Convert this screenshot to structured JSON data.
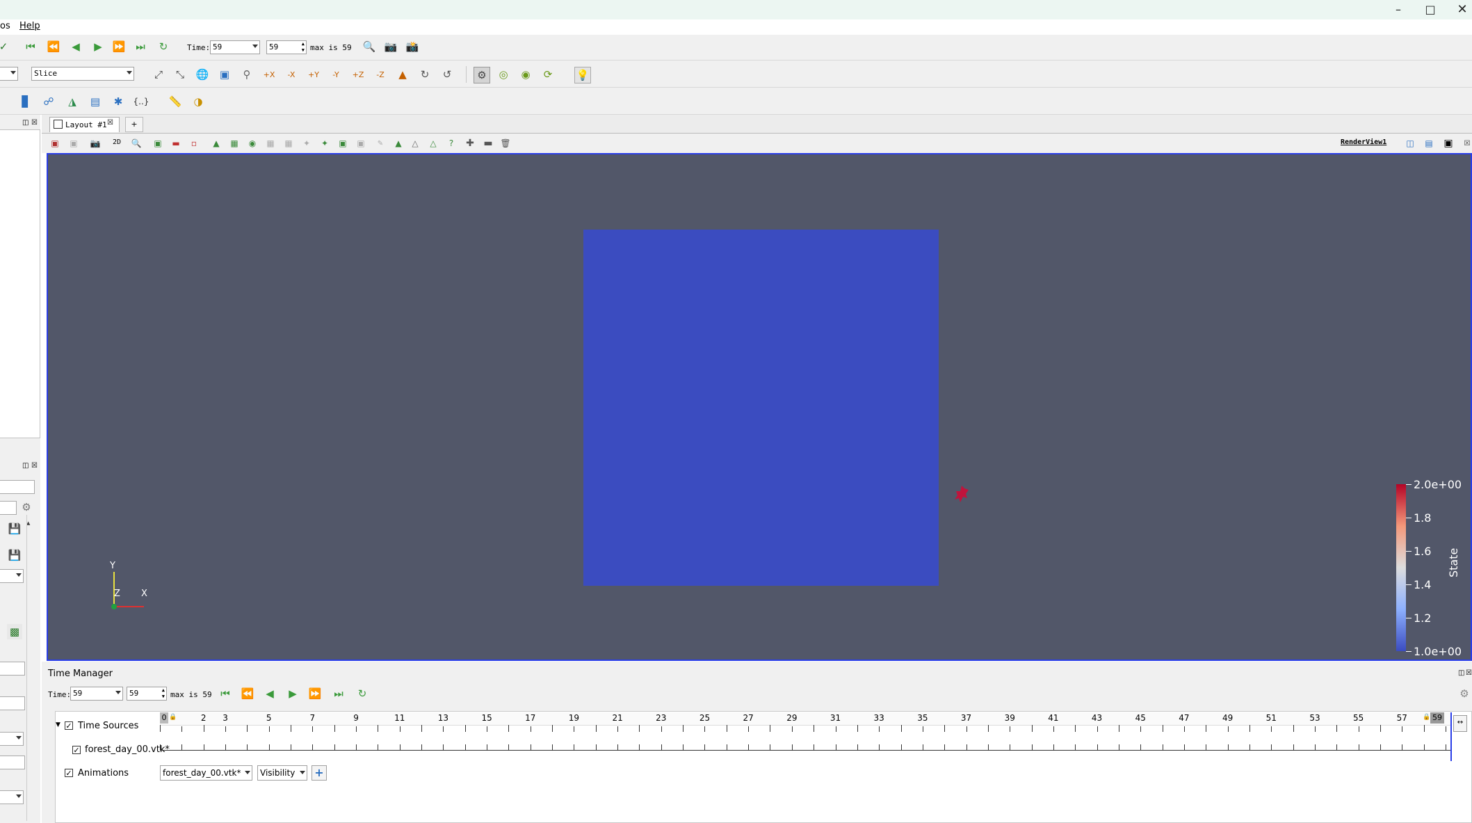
{
  "menu": {
    "sources_partial": "os",
    "help": "Help"
  },
  "time_toolbar": {
    "label": "Time:",
    "time_value": "59",
    "index_value": "59",
    "max_text": "max is 59"
  },
  "representation": {
    "value": "Slice"
  },
  "layout_tab": {
    "label": "Layout #1",
    "add": "+"
  },
  "view": {
    "name": "RenderView1",
    "mode_2d": "2D",
    "background": "#525769",
    "domain_color": "#3b4cc0",
    "fire_color": "#c0143c"
  },
  "axes": {
    "y": "Y",
    "z": "Z",
    "x": "X"
  },
  "colorbar": {
    "title": "State",
    "labels": [
      "2.0e+00",
      "1.8",
      "1.6",
      "1.4",
      "1.2",
      "1.0e+00"
    ],
    "range": [
      1.0,
      2.0
    ],
    "colors": [
      "#b40426",
      "#f4987a",
      "#dddddd",
      "#8db0fe",
      "#3b4cc0"
    ]
  },
  "time_manager": {
    "title": "Time Manager",
    "label": "Time:",
    "time_value": "59",
    "index_value": "59",
    "max_text": "max is 59",
    "time_sources_label": "Time Sources",
    "source_file": "forest_day_00.vtk*",
    "animations_label": "Animations",
    "anim_source": "forest_day_00.vtk*",
    "anim_property": "Visibility",
    "add_symbol": "+",
    "timeline_start": "0",
    "timeline_end": "59",
    "timeline_labels": [
      "2",
      "3",
      "5",
      "7",
      "9",
      "11",
      "13",
      "15",
      "17",
      "19",
      "21",
      "23",
      "25",
      "27",
      "29",
      "31",
      "33",
      "35",
      "37",
      "39",
      "41",
      "43",
      "45",
      "47",
      "49",
      "51",
      "53",
      "55",
      "57"
    ]
  }
}
